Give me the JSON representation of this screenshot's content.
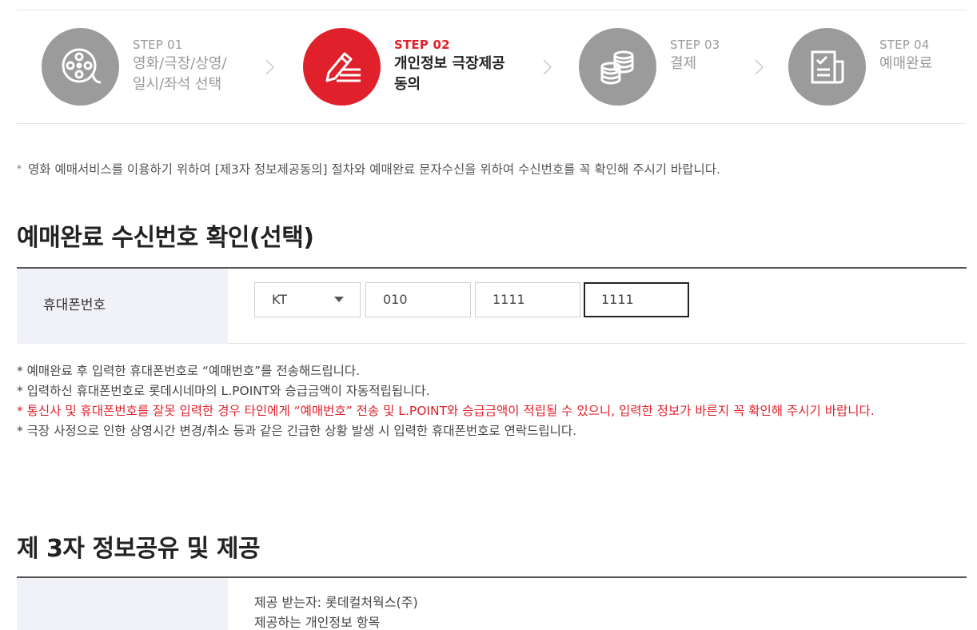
{
  "steps": [
    {
      "num": "STEP 01",
      "label_line1": "영화/극장/상영/",
      "label_line2": "일시/좌석 선택",
      "icon": "film-reel-icon",
      "active": false
    },
    {
      "num": "STEP 02",
      "label_line1": "개인정보 극장제공",
      "label_line2": "동의",
      "icon": "pen-write-icon",
      "active": true
    },
    {
      "num": "STEP 03",
      "label_line1": "결제",
      "label_line2": "",
      "icon": "coins-icon",
      "active": false
    },
    {
      "num": "STEP 04",
      "label_line1": "예매완료",
      "label_line2": "",
      "icon": "receipt-check-icon",
      "active": false
    }
  ],
  "notice": "영화 예매서비스를 이용하기 위하여 [제3자 정보제공동의] 절차와 예매완료 문자수신을 위하여 수신번호를 꼭 확인해 주시기 바랍니다.",
  "notice_star": "*",
  "phone_section": {
    "title": "예매완료 수신번호 확인(선택)",
    "label": "휴대폰번호",
    "carrier": "KT",
    "part1": "010",
    "part2": "1111",
    "part3": "1111"
  },
  "notes": [
    {
      "text": "* 예매완료 후 입력한 휴대폰번호로 “예매번호”를 전송해드립니다.",
      "red": false
    },
    {
      "text": "* 입력하신 휴대폰번호로 롯데시네마의 L.POINT와 승급금액이 자동적립됩니다.",
      "red": false
    },
    {
      "text": "* 통신사 및 휴대폰번호를 잘못 입력한 경우 타인에게 “예매번호” 전송 및 L.POINT와 승급금액이 적립될 수 있으니, 입력한 정보가 바른지 꼭 확인해 주시기 바랍니다.",
      "red": true
    },
    {
      "text": "* 극장 사정으로 인한 상영시간 변경/취소 등과 같은 긴급한 상황 발생 시 입력한 휴대폰번호로 연락드립니다.",
      "red": false
    }
  ],
  "third_party": {
    "title": "제 3자 정보공유 및 제공",
    "line1": "제공 받는자: 롯데컬처웍스(주)",
    "line2": "제공하는 개인정보 항목"
  },
  "colors": {
    "accent": "#e0202a",
    "inactive_step": "#9b9b9b",
    "header_cell_bg": "#f1f1f8"
  }
}
